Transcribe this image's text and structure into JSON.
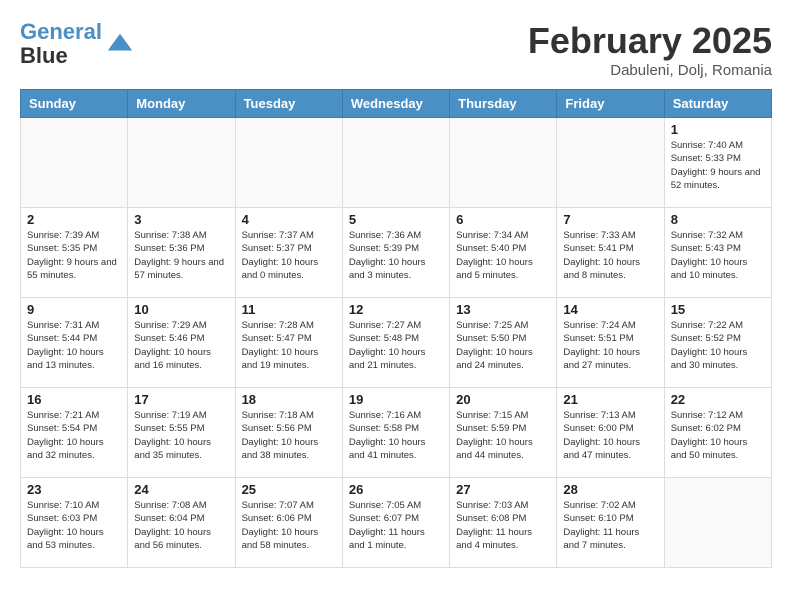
{
  "header": {
    "logo_line1": "General",
    "logo_line2": "Blue",
    "month_title": "February 2025",
    "subtitle": "Dabuleni, Dolj, Romania"
  },
  "weekdays": [
    "Sunday",
    "Monday",
    "Tuesday",
    "Wednesday",
    "Thursday",
    "Friday",
    "Saturday"
  ],
  "weeks": [
    [
      {
        "day": "",
        "info": ""
      },
      {
        "day": "",
        "info": ""
      },
      {
        "day": "",
        "info": ""
      },
      {
        "day": "",
        "info": ""
      },
      {
        "day": "",
        "info": ""
      },
      {
        "day": "",
        "info": ""
      },
      {
        "day": "1",
        "info": "Sunrise: 7:40 AM\nSunset: 5:33 PM\nDaylight: 9 hours and 52 minutes."
      }
    ],
    [
      {
        "day": "2",
        "info": "Sunrise: 7:39 AM\nSunset: 5:35 PM\nDaylight: 9 hours and 55 minutes."
      },
      {
        "day": "3",
        "info": "Sunrise: 7:38 AM\nSunset: 5:36 PM\nDaylight: 9 hours and 57 minutes."
      },
      {
        "day": "4",
        "info": "Sunrise: 7:37 AM\nSunset: 5:37 PM\nDaylight: 10 hours and 0 minutes."
      },
      {
        "day": "5",
        "info": "Sunrise: 7:36 AM\nSunset: 5:39 PM\nDaylight: 10 hours and 3 minutes."
      },
      {
        "day": "6",
        "info": "Sunrise: 7:34 AM\nSunset: 5:40 PM\nDaylight: 10 hours and 5 minutes."
      },
      {
        "day": "7",
        "info": "Sunrise: 7:33 AM\nSunset: 5:41 PM\nDaylight: 10 hours and 8 minutes."
      },
      {
        "day": "8",
        "info": "Sunrise: 7:32 AM\nSunset: 5:43 PM\nDaylight: 10 hours and 10 minutes."
      }
    ],
    [
      {
        "day": "9",
        "info": "Sunrise: 7:31 AM\nSunset: 5:44 PM\nDaylight: 10 hours and 13 minutes."
      },
      {
        "day": "10",
        "info": "Sunrise: 7:29 AM\nSunset: 5:46 PM\nDaylight: 10 hours and 16 minutes."
      },
      {
        "day": "11",
        "info": "Sunrise: 7:28 AM\nSunset: 5:47 PM\nDaylight: 10 hours and 19 minutes."
      },
      {
        "day": "12",
        "info": "Sunrise: 7:27 AM\nSunset: 5:48 PM\nDaylight: 10 hours and 21 minutes."
      },
      {
        "day": "13",
        "info": "Sunrise: 7:25 AM\nSunset: 5:50 PM\nDaylight: 10 hours and 24 minutes."
      },
      {
        "day": "14",
        "info": "Sunrise: 7:24 AM\nSunset: 5:51 PM\nDaylight: 10 hours and 27 minutes."
      },
      {
        "day": "15",
        "info": "Sunrise: 7:22 AM\nSunset: 5:52 PM\nDaylight: 10 hours and 30 minutes."
      }
    ],
    [
      {
        "day": "16",
        "info": "Sunrise: 7:21 AM\nSunset: 5:54 PM\nDaylight: 10 hours and 32 minutes."
      },
      {
        "day": "17",
        "info": "Sunrise: 7:19 AM\nSunset: 5:55 PM\nDaylight: 10 hours and 35 minutes."
      },
      {
        "day": "18",
        "info": "Sunrise: 7:18 AM\nSunset: 5:56 PM\nDaylight: 10 hours and 38 minutes."
      },
      {
        "day": "19",
        "info": "Sunrise: 7:16 AM\nSunset: 5:58 PM\nDaylight: 10 hours and 41 minutes."
      },
      {
        "day": "20",
        "info": "Sunrise: 7:15 AM\nSunset: 5:59 PM\nDaylight: 10 hours and 44 minutes."
      },
      {
        "day": "21",
        "info": "Sunrise: 7:13 AM\nSunset: 6:00 PM\nDaylight: 10 hours and 47 minutes."
      },
      {
        "day": "22",
        "info": "Sunrise: 7:12 AM\nSunset: 6:02 PM\nDaylight: 10 hours and 50 minutes."
      }
    ],
    [
      {
        "day": "23",
        "info": "Sunrise: 7:10 AM\nSunset: 6:03 PM\nDaylight: 10 hours and 53 minutes."
      },
      {
        "day": "24",
        "info": "Sunrise: 7:08 AM\nSunset: 6:04 PM\nDaylight: 10 hours and 56 minutes."
      },
      {
        "day": "25",
        "info": "Sunrise: 7:07 AM\nSunset: 6:06 PM\nDaylight: 10 hours and 58 minutes."
      },
      {
        "day": "26",
        "info": "Sunrise: 7:05 AM\nSunset: 6:07 PM\nDaylight: 11 hours and 1 minute."
      },
      {
        "day": "27",
        "info": "Sunrise: 7:03 AM\nSunset: 6:08 PM\nDaylight: 11 hours and 4 minutes."
      },
      {
        "day": "28",
        "info": "Sunrise: 7:02 AM\nSunset: 6:10 PM\nDaylight: 11 hours and 7 minutes."
      },
      {
        "day": "",
        "info": ""
      }
    ]
  ]
}
